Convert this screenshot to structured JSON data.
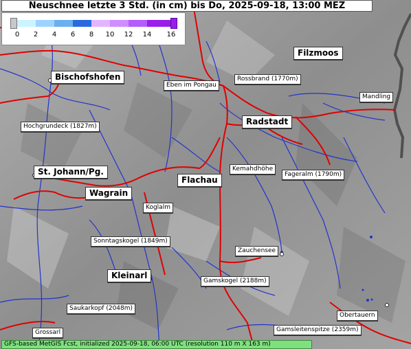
{
  "title": "Neuschnee letzte 3 Std. (in cm) bis Do, 2025-09-18, 13:00 MEZ",
  "legend": {
    "ticks": [
      "0",
      "2",
      "4",
      "6",
      "8",
      "10",
      "12",
      "14",
      "16"
    ],
    "colors": [
      "#c8c8c8",
      "#ccf4ff",
      "#9dd4ff",
      "#6ab0f0",
      "#2a6ae0",
      "#e2b6ff",
      "#cf8dff",
      "#b45cff",
      "#9a1eea"
    ]
  },
  "places": {
    "filzmoos": "Filzmoos",
    "bischofshofen": "Bischofshofen",
    "eben": "Eben im Pongau",
    "rossbrand": "Rossbrand (1770m)",
    "mandling": "Mandling",
    "radstadt": "Radstadt",
    "hochgrundeck": "Hochgrundeck (1827m)",
    "kemahdhoehe": "Kemahdhöhe",
    "stjohann": "St. Johann/Pg.",
    "fageralm": "Fageralm (1790m)",
    "flachau": "Flachau",
    "wagrain": "Wagrain",
    "koglalm": "Koglalm",
    "sonntagskogel": "Sonntagskogel (1849m)",
    "zauchensee": "Zauchensee",
    "kleinarl": "Kleinarl",
    "gamskogel": "Gamskogel (2188m)",
    "saukarkopf": "Saukarkopf (2048m)",
    "obertauern": "Obertauern",
    "grossarl": "Grossarl",
    "gamsleitenspitze": "Gamsleitenspitze (2359m)"
  },
  "footer": "GFS-based MetGIS Fcst, initialized 2025-09-18, 06:00 UTC  (resolution 110 m X 163 m)",
  "colors": {
    "road": "#e00000",
    "river": "#2233cc",
    "border": "#505050",
    "footer_bg": "#80e080"
  }
}
